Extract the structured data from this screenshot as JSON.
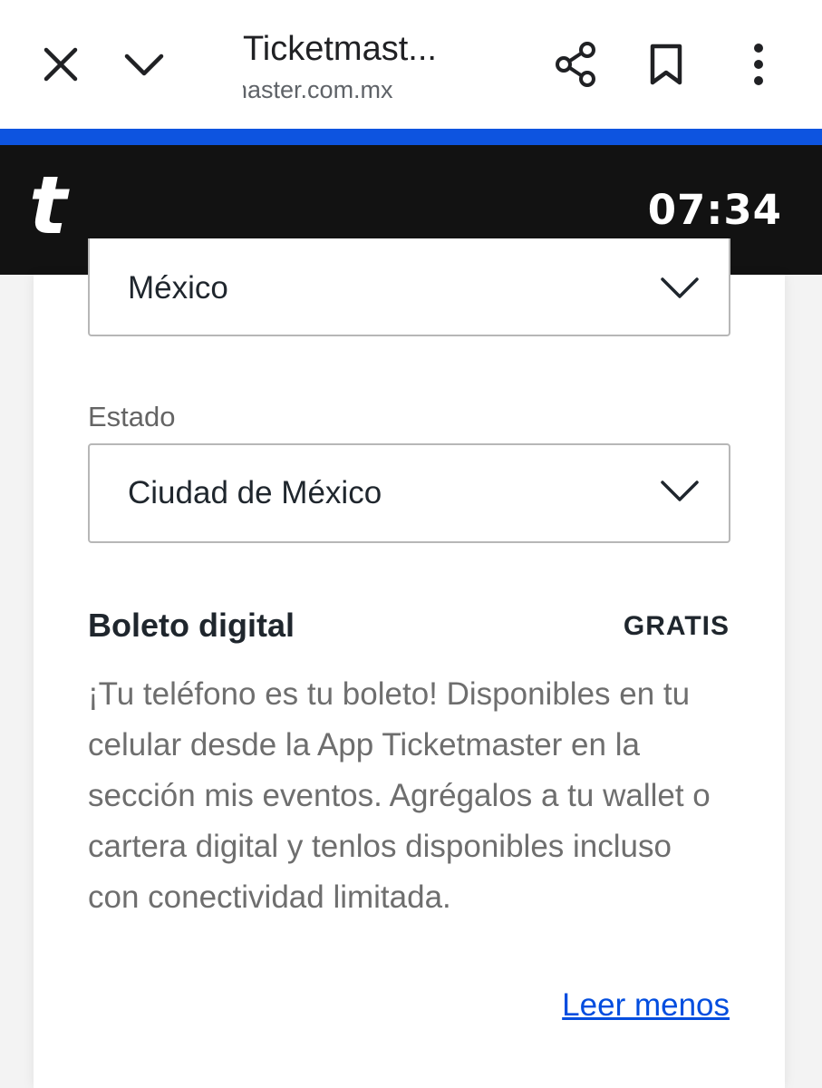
{
  "browser": {
    "page_title": "Ticketmast...",
    "page_url": "naster.com.mx",
    "icons": {
      "close": "close-icon",
      "collapse": "chevron-down-icon",
      "share": "share-icon",
      "bookmark": "bookmark-icon",
      "menu": "more-vert-icon"
    },
    "accent_color": "#0d54e0"
  },
  "header": {
    "logo_text": "t",
    "timer": "07:34",
    "background": "#121212"
  },
  "delivery_form": {
    "country_value": "México",
    "state_label": "Estado",
    "state_value": "Ciudad de México"
  },
  "delivery_option": {
    "title": "Boleto digital",
    "price": "GRATIS",
    "description": "¡Tu teléfono es tu boleto! Disponibles en tu celular desde la App Ticketmaster en la sección mis eventos. Agrégalos a tu wallet o cartera digital y tenlos disponibles incluso con conectividad limitada.",
    "toggle_link": "Leer menos",
    "link_color": "#024ddf"
  }
}
